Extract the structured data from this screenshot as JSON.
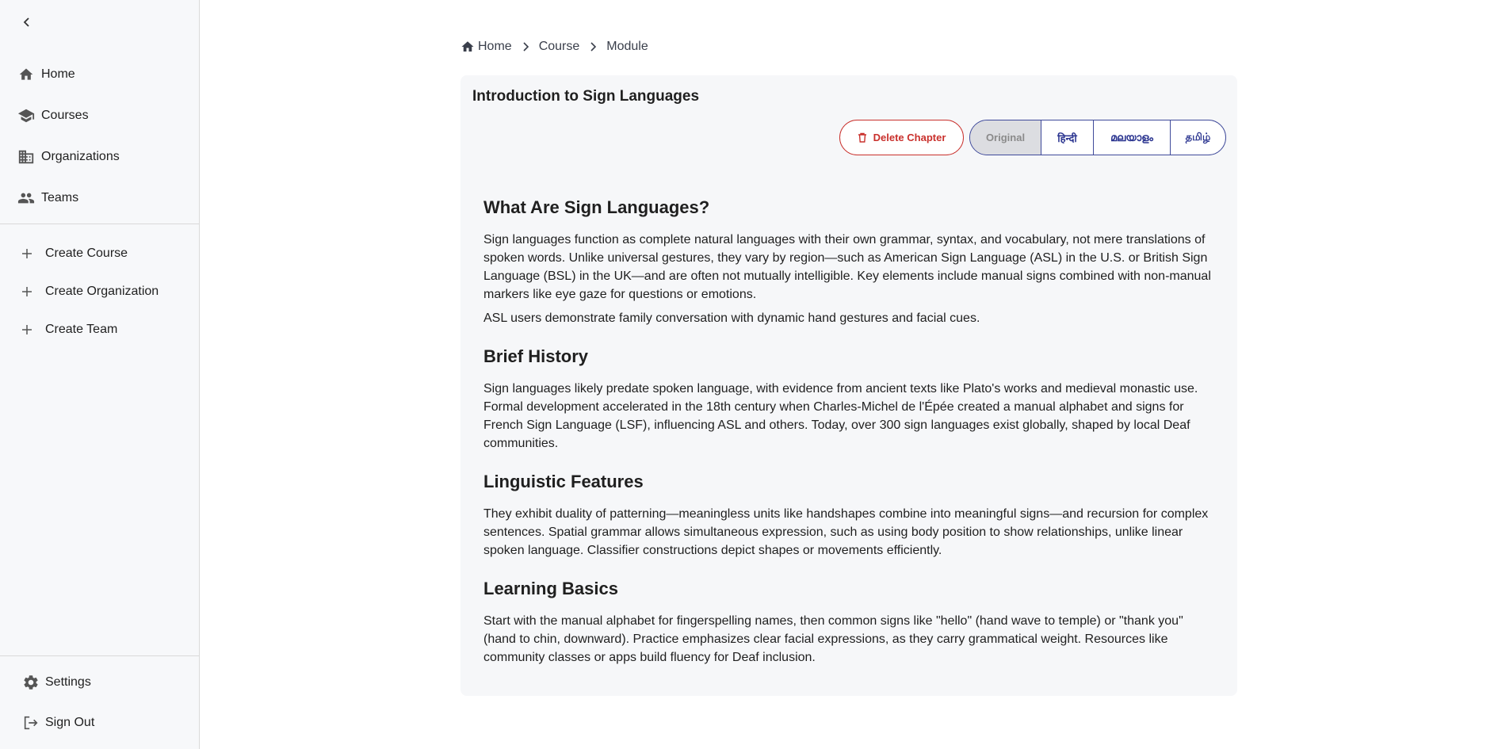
{
  "sidebar": {
    "nav": [
      {
        "label": "Home",
        "icon": "home-icon"
      },
      {
        "label": "Courses",
        "icon": "school-icon"
      },
      {
        "label": "Organizations",
        "icon": "building-icon"
      },
      {
        "label": "Teams",
        "icon": "people-icon"
      }
    ],
    "create": [
      {
        "label": "Create Course"
      },
      {
        "label": "Create Organization"
      },
      {
        "label": "Create Team"
      }
    ],
    "bottom": [
      {
        "label": "Settings",
        "icon": "gear-icon"
      },
      {
        "label": "Sign Out",
        "icon": "logout-icon"
      }
    ]
  },
  "breadcrumb": {
    "home": "Home",
    "course": "Course",
    "module": "Module"
  },
  "chapter": {
    "title": "Introduction to Sign Languages",
    "delete_label": "Delete Chapter",
    "languages": [
      "Original",
      "हिन्दी",
      "മലയാളം",
      "தமிழ்"
    ]
  },
  "content": {
    "sections": [
      {
        "heading": "What Are Sign Languages?",
        "paragraphs": [
          "Sign languages function as complete natural languages with their own grammar, syntax, and vocabulary, not mere translations of spoken words. Unlike universal gestures, they vary by region—such as American Sign Language (ASL) in the U.S. or British Sign Language (BSL) in the UK—and are often not mutually intelligible. Key elements include manual signs combined with non-manual markers like eye gaze for questions or emotions.",
          "ASL users demonstrate family conversation with dynamic hand gestures and facial cues."
        ]
      },
      {
        "heading": "Brief History",
        "paragraphs": [
          "Sign languages likely predate spoken language, with evidence from ancient texts like Plato's works and medieval monastic use. Formal development accelerated in the 18th century when Charles-Michel de l'Épée created a manual alphabet and signs for French Sign Language (LSF), influencing ASL and others. Today, over 300 sign languages exist globally, shaped by local Deaf communities."
        ]
      },
      {
        "heading": "Linguistic Features",
        "paragraphs": [
          "They exhibit duality of patterning—meaningless units like handshapes combine into meaningful signs—and recursion for complex sentences. Spatial grammar allows simultaneous expression, such as using body position to show relationships, unlike linear spoken language. Classifier constructions depict shapes or movements efficiently."
        ]
      },
      {
        "heading": "Learning Basics",
        "paragraphs": [
          "Start with the manual alphabet for fingerspelling names, then common signs like \"hello\" (hand wave to temple) or \"thank you\" (hand to chin, downward). Practice emphasizes clear facial expressions, as they carry grammatical weight. Resources like community classes or apps build fluency for Deaf inclusion."
        ]
      }
    ]
  },
  "colors": {
    "danger": "#c9302c",
    "accent": "#3f4a9a",
    "card_bg": "#f6f7f9",
    "sidebar_bg": "#f7f8fa"
  }
}
